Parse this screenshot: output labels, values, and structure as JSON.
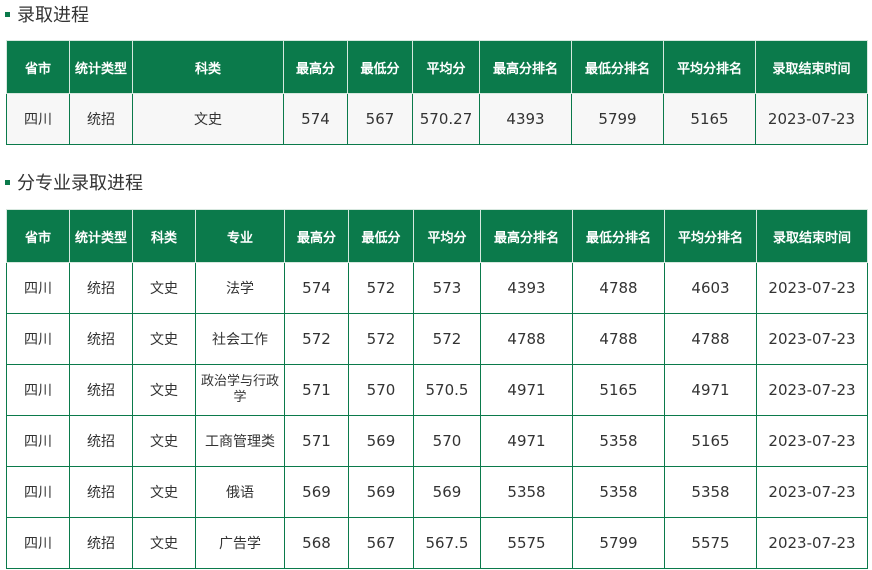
{
  "section1": {
    "title": "录取进程",
    "headers": [
      "省市",
      "统计类型",
      "科类",
      "最高分",
      "最低分",
      "平均分",
      "最高分排名",
      "最低分排名",
      "平均分排名",
      "录取结束时间"
    ],
    "rows": [
      [
        "四川",
        "统招",
        "文史",
        "574",
        "567",
        "570.27",
        "4393",
        "5799",
        "5165",
        "2023-07-23"
      ]
    ]
  },
  "section2": {
    "title": "分专业录取进程",
    "headers": [
      "省市",
      "统计类型",
      "科类",
      "专业",
      "最高分",
      "最低分",
      "平均分",
      "最高分排名",
      "最低分排名",
      "平均分排名",
      "录取结束时间"
    ],
    "rows": [
      [
        "四川",
        "统招",
        "文史",
        "法学",
        "574",
        "572",
        "573",
        "4393",
        "4788",
        "4603",
        "2023-07-23"
      ],
      [
        "四川",
        "统招",
        "文史",
        "社会工作",
        "572",
        "572",
        "572",
        "4788",
        "4788",
        "4788",
        "2023-07-23"
      ],
      [
        "四川",
        "统招",
        "文史",
        "政治学与行政学",
        "571",
        "570",
        "570.5",
        "4971",
        "5165",
        "4971",
        "2023-07-23"
      ],
      [
        "四川",
        "统招",
        "文史",
        "工商管理类",
        "571",
        "569",
        "570",
        "4971",
        "5358",
        "5165",
        "2023-07-23"
      ],
      [
        "四川",
        "统招",
        "文史",
        "俄语",
        "569",
        "569",
        "569",
        "5358",
        "5358",
        "5358",
        "2023-07-23"
      ],
      [
        "四川",
        "统招",
        "文史",
        "广告学",
        "568",
        "567",
        "567.5",
        "5575",
        "5799",
        "5575",
        "2023-07-23"
      ]
    ]
  },
  "colors": {
    "accent": "#0b7a4b",
    "header_text": "#ffffff",
    "text": "#333333"
  }
}
